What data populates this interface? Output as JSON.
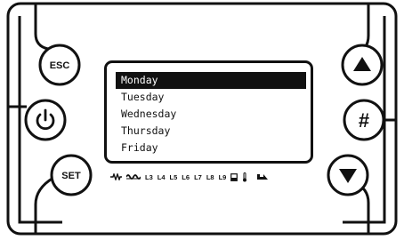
{
  "buttons": {
    "esc": "ESC",
    "set": "SET",
    "hash": "#"
  },
  "menu": {
    "items": [
      "Monday",
      "Tuesday",
      "Wednesday",
      "Thursday",
      "Friday"
    ],
    "selected_index": 0
  },
  "indicators": {
    "levels": [
      "L3",
      "L4",
      "L5",
      "L6",
      "L7",
      "L8",
      "L9"
    ]
  },
  "colors": {
    "ink": "#111111",
    "background": "#ffffff",
    "selection_bg": "#111111",
    "selection_fg": "#ffffff"
  }
}
